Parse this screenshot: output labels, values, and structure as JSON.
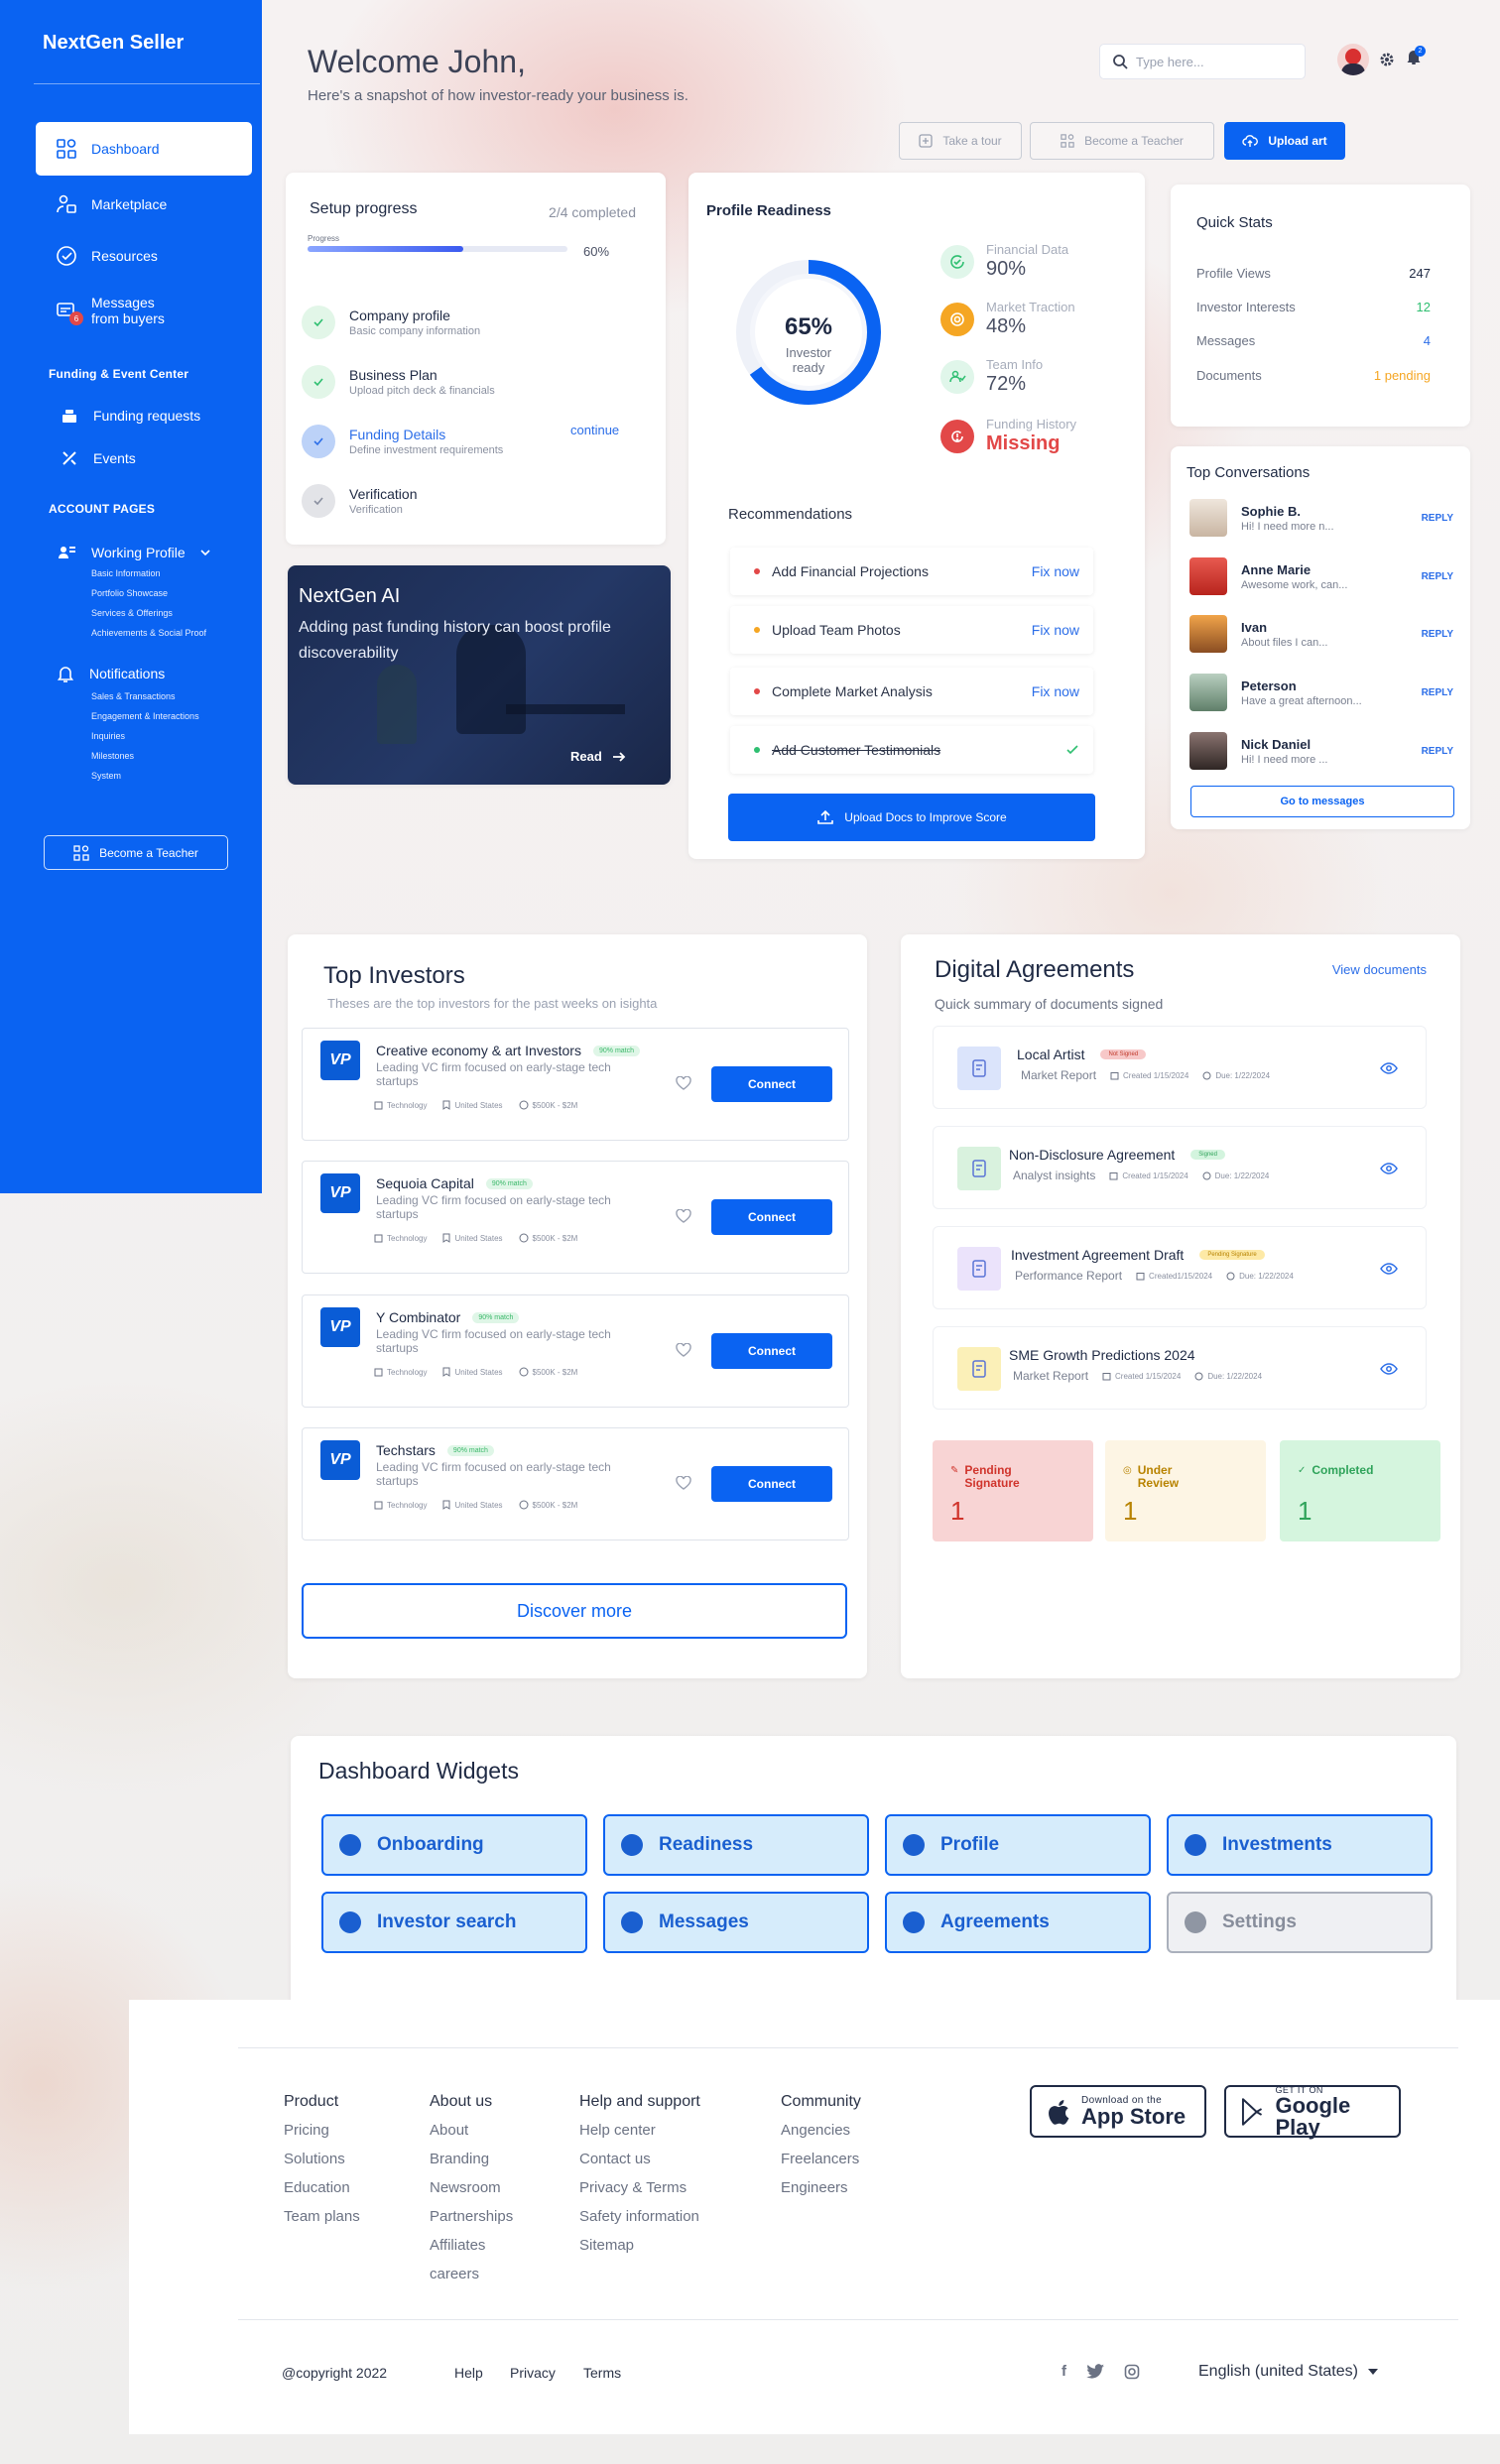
{
  "app": {
    "brand": "NextGen Seller"
  },
  "sidebar": {
    "nav": [
      {
        "label": "Dashboard",
        "icon": "dashboard-icon"
      },
      {
        "label": "Marketplace",
        "icon": "marketplace-icon"
      },
      {
        "label": "Resources",
        "icon": "resources-icon"
      },
      {
        "label": "Messages\nfrom buyers",
        "icon": "messages-icon",
        "badge": "6"
      }
    ],
    "funding_title": "Funding & Event Center",
    "funding_items": [
      {
        "label": "Funding requests",
        "icon": "funding-icon"
      },
      {
        "label": "Events",
        "icon": "events-icon"
      }
    ],
    "account_title": "ACCOUNT PAGES",
    "working_profile": "Working Profile",
    "working_profile_links": [
      "Basic Information",
      "Portfolio Showcase",
      "Services & Offerings",
      "Achievements & Social Proof"
    ],
    "notifications": "Notifications",
    "notification_links": [
      "Sales & Transactions",
      "Engagement & Interactions",
      "Inquiries",
      "Milestones",
      "System"
    ],
    "teacher_button": "Become a Teacher"
  },
  "header": {
    "welcome": "Welcome John,",
    "subtitle": "Here's a snapshot of how investor-ready your business is.",
    "search_placeholder": "Type here...",
    "notification_count": "2",
    "buttons": {
      "tour": "Take a tour",
      "teacher": "Become a Teacher",
      "upload": "Upload art"
    }
  },
  "setup": {
    "title": "Setup progress",
    "completed": "2/4 completed",
    "progress_label": "Progress",
    "progress_text": "60%",
    "progress_value": 0.6,
    "items": [
      {
        "title": "Company profile",
        "sub": "Basic company information",
        "state": "done"
      },
      {
        "title": "Business Plan",
        "sub": "Upload pitch deck & financials",
        "state": "done"
      },
      {
        "title": "Funding Details",
        "sub": "Define investment requirements",
        "state": "active",
        "action": "continue"
      },
      {
        "title": "Verification",
        "sub": "Verification",
        "state": "pending"
      }
    ]
  },
  "ai": {
    "title": "NextGen AI",
    "text": "Adding past funding history can boost profile discoverability",
    "read": "Read"
  },
  "readiness": {
    "title": "Profile Readiness",
    "percent_text": "65%",
    "percent_value": 0.65,
    "caption": "Investor ready",
    "metrics": [
      {
        "label": "Financial Data",
        "value": "90%",
        "color": "#2fbf71",
        "icon": "refresh-check-icon"
      },
      {
        "label": "Market Traction",
        "value": "48%",
        "color": "#f5a623",
        "icon": "target-icon"
      },
      {
        "label": "Team Info",
        "value": "72%",
        "color": "#2fbf71",
        "icon": "team-icon"
      },
      {
        "label": "Funding History",
        "value": "Missing",
        "color": "#e24848",
        "icon": "funding-alert-icon"
      }
    ],
    "recommendations_title": "Recommendations",
    "recommendations": [
      {
        "label": "Add Financial Projections",
        "action": "Fix now",
        "dot": "#e24848",
        "done": false
      },
      {
        "label": "Upload Team Photos",
        "action": "Fix now",
        "dot": "#f5a623",
        "done": false
      },
      {
        "label": "Complete Market Analysis",
        "action": "Fix now",
        "dot": "#e24848",
        "done": false
      },
      {
        "label": "Add Customer Testimonials",
        "action": "",
        "dot": "#2fbf71",
        "done": true
      }
    ],
    "upload_button": "Upload Docs to Improve Score"
  },
  "quick_stats": {
    "title": "Quick Stats",
    "rows": [
      {
        "label": "Profile Views",
        "value": "247",
        "color": "#1f2a44"
      },
      {
        "label": "Investor Interests",
        "value": "12",
        "color": "#2fbf71"
      },
      {
        "label": "Messages",
        "value": "4",
        "color": "#2c6ee8"
      },
      {
        "label": "Documents",
        "value": "1 pending",
        "color": "#f5a623"
      }
    ]
  },
  "conversations": {
    "title": "Top Conversations",
    "reply": "REPLY",
    "items": [
      {
        "name": "Sophie B.",
        "msg": "Hi! I need more n...",
        "color": "#c9b5a2"
      },
      {
        "name": "Anne Marie",
        "msg": "Awesome work, can...",
        "color": "#d9382f"
      },
      {
        "name": "Ivan",
        "msg": "About files I can...",
        "color": "#e2871f"
      },
      {
        "name": "Peterson",
        "msg": "Have a great afternoon...",
        "color": "#7fa08a"
      },
      {
        "name": "Nick Daniel",
        "msg": "Hi! I need more ...",
        "color": "#4a3d3a"
      }
    ],
    "button": "Go to messages"
  },
  "investors": {
    "title": "Top Investors",
    "subtitle": "Theses are the top investors for the past weeks on isighta",
    "items": [
      {
        "name": "Creative economy & art Investors",
        "match": "90% match",
        "desc": "Leading VC firm focused on early-stage tech startups",
        "sector": "Technology",
        "location": "United States",
        "range": "$500K - $2M"
      },
      {
        "name": "Sequoia Capital",
        "match": "90% match",
        "desc": "Leading VC firm focused on early-stage tech startups",
        "sector": "Technology",
        "location": "United States",
        "range": "$500K - $2M"
      },
      {
        "name": "Y Combinator",
        "match": "90% match",
        "desc": "Leading VC firm focused on early-stage tech startups",
        "sector": "Technology",
        "location": "United States",
        "range": "$500K - $2M"
      },
      {
        "name": "Techstars",
        "match": "90% match",
        "desc": "Leading VC firm focused on early-stage tech startups",
        "sector": "Technology",
        "location": "United States",
        "range": "$500K - $2M"
      }
    ],
    "logo_text": "VP",
    "connect": "Connect",
    "discover": "Discover more"
  },
  "agreements": {
    "title": "Digital Agreements",
    "subtitle": "Quick summary of  documents signed",
    "view": "View documents",
    "items": [
      {
        "title": "Local Artist",
        "pill": "Not Signed",
        "pill_bg": "#f7c8c8",
        "pill_color": "#c0392b",
        "meta": "Market Report",
        "created": "Created 1/15/2024",
        "due": "Due: 1/22/2024",
        "icon_bg": "#dbe4fb"
      },
      {
        "title": "Non-Disclosure Agreement",
        "pill": "Signed",
        "pill_bg": "#d3f4de",
        "pill_color": "#2fa35a",
        "meta": "Analyst insights",
        "created": "Created 1/15/2024",
        "due": "Due: 1/22/2024",
        "icon_bg": "#d9f2de"
      },
      {
        "title": "Investment Agreement Draft",
        "pill": "Pending Signature",
        "pill_bg": "#fde9a6",
        "pill_color": "#b88300",
        "meta": "Performance Report",
        "created": "Created1/15/2024",
        "due": "Due: 1/22/2024",
        "icon_bg": "#ebe3fb"
      },
      {
        "title": "SME Growth Predictions 2024",
        "pill": "",
        "pill_bg": "",
        "pill_color": "",
        "meta": "Market Report",
        "created": "Created 1/15/2024",
        "due": "Due: 1/22/2024",
        "icon_bg": "#fbf0b8"
      }
    ],
    "summary": [
      {
        "label": "Pending Signature",
        "count": "1",
        "bg": "#f8d4d4",
        "color": "#d0342c"
      },
      {
        "label": "Under Review",
        "count": "1",
        "bg": "#fdf5e4",
        "color": "#b88300"
      },
      {
        "label": "Completed",
        "count": "1",
        "bg": "#d5f5de",
        "color": "#2fa35a"
      }
    ]
  },
  "widgets": {
    "title": "Dashboard Widgets",
    "items": [
      {
        "label": "Onboarding",
        "on": true
      },
      {
        "label": "Readiness",
        "on": true
      },
      {
        "label": "Profile",
        "on": true
      },
      {
        "label": "Investments",
        "on": true
      },
      {
        "label": "Investor search",
        "on": true
      },
      {
        "label": "Messages",
        "on": true
      },
      {
        "label": "Agreements",
        "on": true
      },
      {
        "label": "Settings",
        "on": false
      }
    ]
  },
  "footer": {
    "columns": [
      {
        "title": "Product",
        "links": [
          "Pricing",
          "Solutions",
          "Education",
          "Team plans"
        ]
      },
      {
        "title": "About us",
        "links": [
          "About",
          "Branding",
          "Newsroom",
          "Partnerships",
          "Affiliates",
          "careers"
        ]
      },
      {
        "title": "Help and support",
        "links": [
          "Help center",
          "Contact us",
          "Privacy & Terms",
          "Safety information",
          "Sitemap"
        ]
      },
      {
        "title": "Community",
        "links": [
          "Angencies",
          "Freelancers",
          "Engineers"
        ]
      }
    ],
    "app_store": {
      "small": "Download on the",
      "big": "App Store"
    },
    "google_play": {
      "small": "GET IT ON",
      "big": "Google Play"
    },
    "copyright": "@copyright 2022",
    "bottom_links": [
      "Help",
      "Privacy",
      "Terms"
    ],
    "language": "English (united States)"
  }
}
